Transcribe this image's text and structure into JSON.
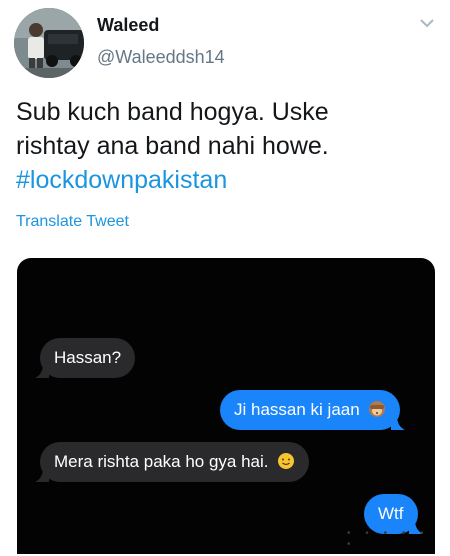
{
  "tweet": {
    "display_name": "Waleed",
    "handle": "@Waleeddsh14",
    "text_line1": "Sub kuch band hogya. Uske",
    "text_line2": "rishtay ana band nahi howe.",
    "hashtag": "#lockdownpakistan",
    "translate_label": "Translate Tweet"
  },
  "media": {
    "messages": [
      {
        "direction": "received",
        "text": "Hassan?"
      },
      {
        "direction": "sent",
        "text": "Ji hassan ki jaan",
        "emoji": "see-no-evil-monkey"
      },
      {
        "direction": "received",
        "text": "Mera rishta paka ho gya hai.",
        "emoji": "smiling-face"
      },
      {
        "direction": "sent",
        "text": "Wtf"
      }
    ]
  },
  "colors": {
    "hashtag": "#1b95e0",
    "handle": "#657786",
    "sent_bubble": "#1a84fb",
    "received_bubble": "#2a2a2c",
    "media_background": "#030303"
  }
}
